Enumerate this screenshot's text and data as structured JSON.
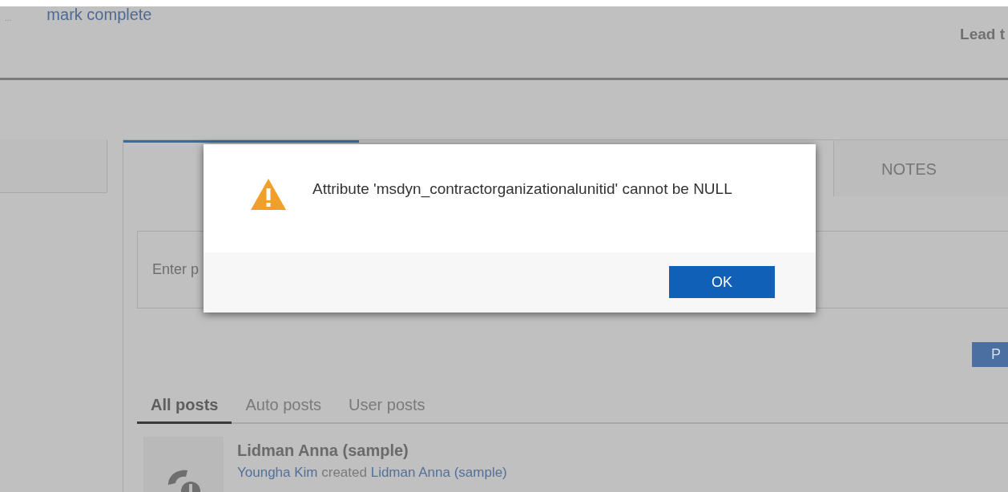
{
  "header": {
    "ellipsis": "...",
    "action_link": "mark complete",
    "title": "Lead t"
  },
  "record_tabs": [
    {
      "selected": true
    },
    {
      "selected": false
    },
    {
      "label": "NOTES",
      "selected": false
    }
  ],
  "post_box": {
    "placeholder": "Enter p"
  },
  "post_button": "P",
  "feed_tabs": [
    {
      "label": "All posts",
      "selected": true
    },
    {
      "label": "Auto posts",
      "selected": false
    },
    {
      "label": "User posts",
      "selected": false
    }
  ],
  "posts": [
    {
      "title": "Lidman Anna (sample)",
      "author": "Youngha Kim",
      "verb": "created",
      "target": "Lidman Anna (sample)"
    }
  ],
  "dialog": {
    "kind": "warning",
    "message": "Attribute 'msdyn_contractorganizationalunitid' cannot be NULL",
    "button": "OK"
  }
}
